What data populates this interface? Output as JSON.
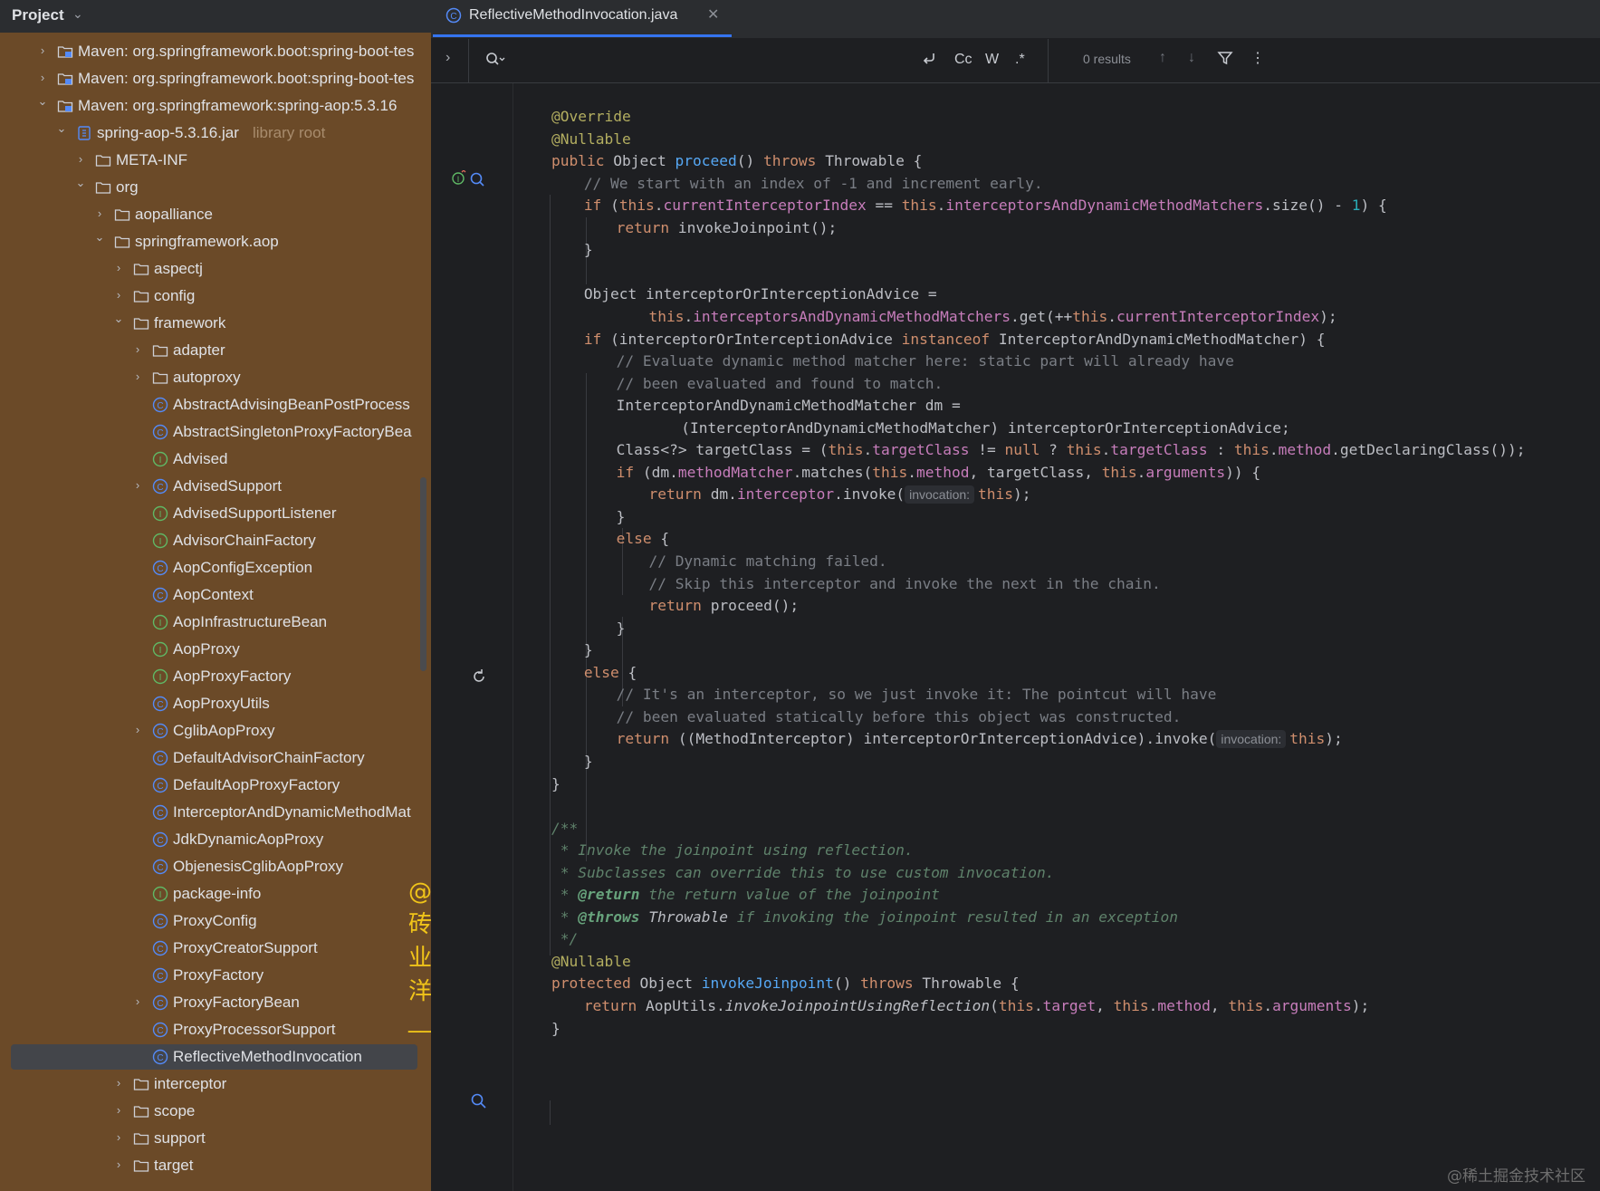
{
  "sidebar": {
    "title": "Project",
    "tree": [
      {
        "depth": 0,
        "chev": "right",
        "icon": "module",
        "label": "Maven: org.springframework.boot:spring-boot-tes"
      },
      {
        "depth": 0,
        "chev": "right",
        "icon": "module",
        "label": "Maven: org.springframework.boot:spring-boot-tes"
      },
      {
        "depth": 0,
        "chev": "down",
        "icon": "module",
        "label": "Maven: org.springframework:spring-aop:5.3.16"
      },
      {
        "depth": 1,
        "chev": "down",
        "icon": "jar",
        "label": "spring-aop-5.3.16.jar",
        "muted": "library root"
      },
      {
        "depth": 2,
        "chev": "right",
        "icon": "folder",
        "label": "META-INF"
      },
      {
        "depth": 2,
        "chev": "down",
        "icon": "folder",
        "label": "org"
      },
      {
        "depth": 3,
        "chev": "right",
        "icon": "folder",
        "label": "aopalliance"
      },
      {
        "depth": 3,
        "chev": "down",
        "icon": "folder",
        "label": "springframework.aop"
      },
      {
        "depth": 4,
        "chev": "right",
        "icon": "folder",
        "label": "aspectj"
      },
      {
        "depth": 4,
        "chev": "right",
        "icon": "folder",
        "label": "config"
      },
      {
        "depth": 4,
        "chev": "down",
        "icon": "folder",
        "label": "framework"
      },
      {
        "depth": 5,
        "chev": "right",
        "icon": "folder",
        "label": "adapter"
      },
      {
        "depth": 5,
        "chev": "right",
        "icon": "folder",
        "label": "autoproxy"
      },
      {
        "depth": 5,
        "chev": "",
        "icon": "class",
        "label": "AbstractAdvisingBeanPostProcess"
      },
      {
        "depth": 5,
        "chev": "",
        "icon": "class",
        "label": "AbstractSingletonProxyFactoryBea"
      },
      {
        "depth": 5,
        "chev": "",
        "icon": "interface",
        "label": "Advised"
      },
      {
        "depth": 5,
        "chev": "right",
        "icon": "class",
        "label": "AdvisedSupport"
      },
      {
        "depth": 5,
        "chev": "",
        "icon": "interface",
        "label": "AdvisedSupportListener"
      },
      {
        "depth": 5,
        "chev": "",
        "icon": "interface",
        "label": "AdvisorChainFactory"
      },
      {
        "depth": 5,
        "chev": "",
        "icon": "class",
        "label": "AopConfigException"
      },
      {
        "depth": 5,
        "chev": "",
        "icon": "class",
        "label": "AopContext"
      },
      {
        "depth": 5,
        "chev": "",
        "icon": "interface",
        "label": "AopInfrastructureBean"
      },
      {
        "depth": 5,
        "chev": "",
        "icon": "interface",
        "label": "AopProxy"
      },
      {
        "depth": 5,
        "chev": "",
        "icon": "interface",
        "label": "AopProxyFactory"
      },
      {
        "depth": 5,
        "chev": "",
        "icon": "class",
        "label": "AopProxyUtils"
      },
      {
        "depth": 5,
        "chev": "right",
        "icon": "class",
        "label": "CglibAopProxy"
      },
      {
        "depth": 5,
        "chev": "",
        "icon": "class",
        "label": "DefaultAdvisorChainFactory"
      },
      {
        "depth": 5,
        "chev": "",
        "icon": "class",
        "label": "DefaultAopProxyFactory"
      },
      {
        "depth": 5,
        "chev": "",
        "icon": "class",
        "label": "InterceptorAndDynamicMethodMat"
      },
      {
        "depth": 5,
        "chev": "",
        "icon": "class",
        "label": "JdkDynamicAopProxy"
      },
      {
        "depth": 5,
        "chev": "",
        "icon": "class",
        "label": "ObjenesisCglibAopProxy"
      },
      {
        "depth": 5,
        "chev": "",
        "icon": "interface",
        "label": "package-info"
      },
      {
        "depth": 5,
        "chev": "",
        "icon": "class",
        "label": "ProxyConfig"
      },
      {
        "depth": 5,
        "chev": "",
        "icon": "class",
        "label": "ProxyCreatorSupport"
      },
      {
        "depth": 5,
        "chev": "",
        "icon": "class",
        "label": "ProxyFactory"
      },
      {
        "depth": 5,
        "chev": "right",
        "icon": "class",
        "label": "ProxyFactoryBean"
      },
      {
        "depth": 5,
        "chev": "",
        "icon": "class",
        "label": "ProxyProcessorSupport"
      },
      {
        "depth": 5,
        "chev": "",
        "icon": "class",
        "label": "ReflectiveMethodInvocation",
        "selected": true
      },
      {
        "depth": 4,
        "chev": "right",
        "icon": "folder",
        "label": "interceptor"
      },
      {
        "depth": 4,
        "chev": "right",
        "icon": "folder",
        "label": "scope"
      },
      {
        "depth": 4,
        "chev": "right",
        "icon": "folder",
        "label": "support"
      },
      {
        "depth": 4,
        "chev": "right",
        "icon": "folder",
        "label": "target"
      }
    ]
  },
  "editor": {
    "tab_label": "ReflectiveMethodInvocation.java",
    "find": {
      "case_label": "Cc",
      "words_label": "W",
      "regex_label": ".*",
      "results": "0 results"
    },
    "hint_label": "invocation:",
    "lines": [
      {
        "indent": 0,
        "tokens": [
          [
            "ann",
            "@Override"
          ]
        ]
      },
      {
        "indent": 0,
        "tokens": [
          [
            "ann",
            "@Nullable"
          ]
        ]
      },
      {
        "indent": 0,
        "tokens": [
          [
            "kw",
            "public "
          ],
          [
            "",
            "Object "
          ],
          [
            "fn",
            "proceed"
          ],
          [
            "",
            "() "
          ],
          [
            "kw",
            "throws "
          ],
          [
            "",
            "Throwable {"
          ]
        ]
      },
      {
        "indent": 1,
        "tokens": [
          [
            "cm",
            "// We start with an index of -1 and increment early."
          ]
        ]
      },
      {
        "indent": 1,
        "tokens": [
          [
            "kw",
            "if "
          ],
          [
            "",
            "("
          ],
          [
            "kw",
            "this"
          ],
          [
            "",
            "."
          ],
          [
            "fld",
            "currentInterceptorIndex"
          ],
          [
            "",
            " == "
          ],
          [
            "kw",
            "this"
          ],
          [
            "",
            "."
          ],
          [
            "fld",
            "interceptorsAndDynamicMethodMatchers"
          ],
          [
            "",
            ".size() - "
          ],
          [
            "num",
            "1"
          ],
          [
            "",
            ") {"
          ]
        ]
      },
      {
        "indent": 2,
        "tokens": [
          [
            "kw",
            "return "
          ],
          [
            "",
            "invokeJoinpoint();"
          ]
        ]
      },
      {
        "indent": 1,
        "tokens": [
          [
            "",
            "}"
          ]
        ]
      },
      {
        "indent": 0,
        "tokens": []
      },
      {
        "indent": 1,
        "tokens": [
          [
            "",
            "Object interceptorOrInterceptionAdvice ="
          ]
        ]
      },
      {
        "indent": 3,
        "tokens": [
          [
            "kw",
            "this"
          ],
          [
            "",
            "."
          ],
          [
            "fld",
            "interceptorsAndDynamicMethodMatchers"
          ],
          [
            "",
            ".get(++"
          ],
          [
            "kw",
            "this"
          ],
          [
            "",
            "."
          ],
          [
            "fld",
            "currentInterceptorIndex"
          ],
          [
            "",
            ");"
          ]
        ]
      },
      {
        "indent": 1,
        "tokens": [
          [
            "kw",
            "if "
          ],
          [
            "",
            "(interceptorOrInterceptionAdvice "
          ],
          [
            "kw",
            "instanceof "
          ],
          [
            "",
            "InterceptorAndDynamicMethodMatcher) {"
          ]
        ]
      },
      {
        "indent": 2,
        "tokens": [
          [
            "cm",
            "// Evaluate dynamic method matcher here: static part will already have"
          ]
        ]
      },
      {
        "indent": 2,
        "tokens": [
          [
            "cm",
            "// been evaluated and found to match."
          ]
        ]
      },
      {
        "indent": 2,
        "tokens": [
          [
            "",
            "InterceptorAndDynamicMethodMatcher dm ="
          ]
        ]
      },
      {
        "indent": 4,
        "tokens": [
          [
            "",
            "(InterceptorAndDynamicMethodMatcher) interceptorOrInterceptionAdvice;"
          ]
        ]
      },
      {
        "indent": 2,
        "tokens": [
          [
            "",
            "Class<?> targetClass = ("
          ],
          [
            "kw",
            "this"
          ],
          [
            "",
            "."
          ],
          [
            "fld",
            "targetClass"
          ],
          [
            "",
            " != "
          ],
          [
            "kw",
            "null"
          ],
          [
            "",
            " ? "
          ],
          [
            "kw",
            "this"
          ],
          [
            "",
            "."
          ],
          [
            "fld",
            "targetClass"
          ],
          [
            "",
            " : "
          ],
          [
            "kw",
            "this"
          ],
          [
            "",
            "."
          ],
          [
            "fld",
            "method"
          ],
          [
            "",
            ".getDeclaringClass());"
          ]
        ]
      },
      {
        "indent": 2,
        "tokens": [
          [
            "kw",
            "if "
          ],
          [
            "",
            "(dm."
          ],
          [
            "fld",
            "methodMatcher"
          ],
          [
            "",
            ".matches("
          ],
          [
            "kw",
            "this"
          ],
          [
            "",
            "."
          ],
          [
            "fld",
            "method"
          ],
          [
            "",
            ", targetClass, "
          ],
          [
            "kw",
            "this"
          ],
          [
            "",
            "."
          ],
          [
            "fld",
            "arguments"
          ],
          [
            "",
            ")) {"
          ]
        ]
      },
      {
        "indent": 3,
        "tokens": [
          [
            "kw",
            "return "
          ],
          [
            "",
            "dm."
          ],
          [
            "fld",
            "interceptor"
          ],
          [
            "",
            ".invoke("
          ],
          [
            "hint",
            "invocation:"
          ],
          [
            "kw",
            "this"
          ],
          [
            "",
            ");"
          ]
        ]
      },
      {
        "indent": 2,
        "tokens": [
          [
            "",
            "}"
          ]
        ]
      },
      {
        "indent": 2,
        "tokens": [
          [
            "kw",
            "else "
          ],
          [
            "",
            "{"
          ]
        ]
      },
      {
        "indent": 3,
        "tokens": [
          [
            "cm",
            "// Dynamic matching failed."
          ]
        ]
      },
      {
        "indent": 3,
        "tokens": [
          [
            "cm",
            "// Skip this interceptor and invoke the next in the chain."
          ]
        ]
      },
      {
        "indent": 3,
        "tokens": [
          [
            "kw",
            "return "
          ],
          [
            "",
            "proceed();"
          ]
        ]
      },
      {
        "indent": 2,
        "tokens": [
          [
            "",
            "}"
          ]
        ]
      },
      {
        "indent": 1,
        "tokens": [
          [
            "",
            "}"
          ]
        ]
      },
      {
        "indent": 1,
        "tokens": [
          [
            "kw",
            "else "
          ],
          [
            "",
            "{"
          ]
        ]
      },
      {
        "indent": 2,
        "tokens": [
          [
            "cm",
            "// It's an interceptor, so we just invoke it: The pointcut will have"
          ]
        ]
      },
      {
        "indent": 2,
        "tokens": [
          [
            "cm",
            "// been evaluated statically before this object was constructed."
          ]
        ]
      },
      {
        "indent": 2,
        "tokens": [
          [
            "kw",
            "return "
          ],
          [
            "",
            "((MethodInterceptor) interceptorOrInterceptionAdvice).invoke("
          ],
          [
            "hint",
            "invocation:"
          ],
          [
            "kw",
            "this"
          ],
          [
            "",
            ");"
          ]
        ]
      },
      {
        "indent": 1,
        "tokens": [
          [
            "",
            "}"
          ]
        ]
      },
      {
        "indent": 0,
        "tokens": [
          [
            "",
            "}"
          ]
        ]
      },
      {
        "indent": 0,
        "tokens": []
      },
      {
        "indent": 0,
        "tokens": [
          [
            "dc",
            "/**"
          ]
        ]
      },
      {
        "indent": 0,
        "tokens": [
          [
            "dc",
            " * Invoke the joinpoint using reflection."
          ]
        ]
      },
      {
        "indent": 0,
        "tokens": [
          [
            "dc",
            " * Subclasses can override this to use custom invocation."
          ]
        ]
      },
      {
        "indent": 0,
        "tokens": [
          [
            "dc",
            " * "
          ],
          [
            "dct",
            "@return"
          ],
          [
            "dc",
            " the return value of the joinpoint"
          ]
        ]
      },
      {
        "indent": 0,
        "tokens": [
          [
            "dc",
            " * "
          ],
          [
            "dct",
            "@throws"
          ],
          [
            "dcw",
            " Throwable"
          ],
          [
            "dc",
            " if invoking the joinpoint resulted in an exception"
          ]
        ]
      },
      {
        "indent": 0,
        "tokens": [
          [
            "dc",
            " */"
          ]
        ]
      },
      {
        "indent": 0,
        "tokens": [
          [
            "ann",
            "@Nullable"
          ]
        ]
      },
      {
        "indent": 0,
        "tokens": [
          [
            "kw",
            "protected "
          ],
          [
            "",
            "Object "
          ],
          [
            "fn",
            "invokeJoinpoint"
          ],
          [
            "",
            "() "
          ],
          [
            "kw",
            "throws "
          ],
          [
            "",
            "Throwable {"
          ]
        ]
      },
      {
        "indent": 1,
        "tokens": [
          [
            "kw",
            "return "
          ],
          [
            "",
            "AopUtils."
          ],
          [
            "dcw",
            "invokeJoinpointUsingReflection"
          ],
          [
            "",
            "("
          ],
          [
            "kw",
            "this"
          ],
          [
            "",
            "."
          ],
          [
            "fld",
            "target"
          ],
          [
            "",
            ", "
          ],
          [
            "kw",
            "this"
          ],
          [
            "",
            "."
          ],
          [
            "fld",
            "method"
          ],
          [
            "",
            ", "
          ],
          [
            "kw",
            "this"
          ],
          [
            "",
            "."
          ],
          [
            "fld",
            "arguments"
          ],
          [
            "",
            ");"
          ]
        ]
      },
      {
        "indent": 0,
        "tokens": [
          [
            "",
            "}"
          ]
        ]
      }
    ]
  },
  "watermarks": {
    "author": "@砖业洋__",
    "site": "@稀土掘金技术社区"
  },
  "colors": {
    "sidebar_bg": "#6b4a28",
    "editor_bg": "#1e1f22",
    "accent": "#3574f0",
    "keyword": "#cf8e6d",
    "annotation": "#b3ae60",
    "field": "#c77dbb",
    "comment": "#7a7e85",
    "doc": "#5f826b"
  }
}
